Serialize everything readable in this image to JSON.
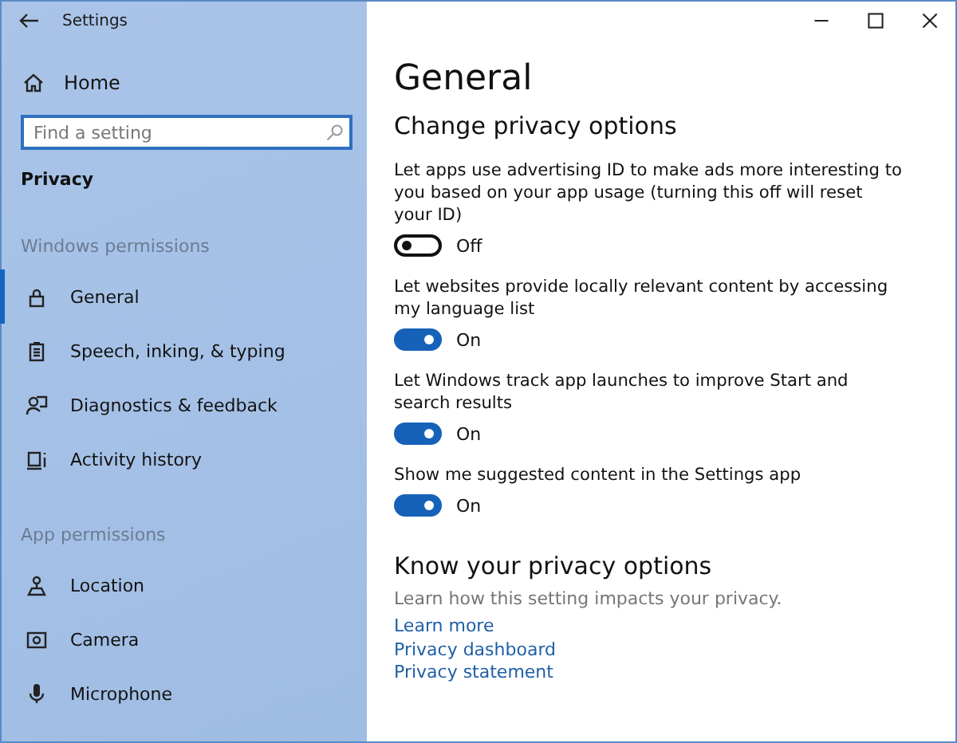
{
  "window": {
    "title": "Settings"
  },
  "sidebar": {
    "home": "Home",
    "search": {
      "placeholder": "Find a setting"
    },
    "section": "Privacy",
    "groups": [
      {
        "heading": "Windows permissions",
        "items": [
          {
            "label": "General",
            "selected": true
          },
          {
            "label": "Speech, inking, & typing",
            "selected": false
          },
          {
            "label": "Diagnostics & feedback",
            "selected": false
          },
          {
            "label": "Activity history",
            "selected": false
          }
        ]
      },
      {
        "heading": "App permissions",
        "items": [
          {
            "label": "Location",
            "selected": false
          },
          {
            "label": "Camera",
            "selected": false
          },
          {
            "label": "Microphone",
            "selected": false
          }
        ]
      }
    ]
  },
  "main": {
    "title": "General",
    "subtitle": "Change privacy options",
    "options": [
      {
        "text": "Let apps use advertising ID to make ads more interesting to you based on your app usage (turning this off will reset your ID)",
        "on": false,
        "state_label": "Off"
      },
      {
        "text": "Let websites provide locally relevant content by accessing my language list",
        "on": true,
        "state_label": "On"
      },
      {
        "text": "Let Windows track app launches to improve Start and search results",
        "on": true,
        "state_label": "On"
      },
      {
        "text": "Show me suggested content in the Settings app",
        "on": true,
        "state_label": "On"
      }
    ],
    "know": {
      "heading": "Know your privacy options",
      "description": "Learn how this setting impacts your privacy.",
      "links": [
        "Learn more",
        "Privacy dashboard",
        "Privacy statement"
      ]
    }
  }
}
